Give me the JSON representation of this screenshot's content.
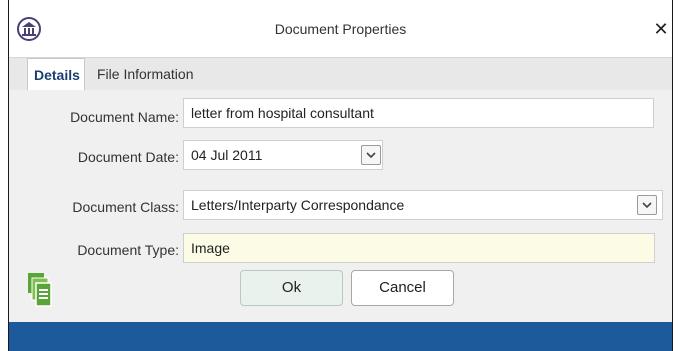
{
  "window": {
    "title": "Document Properties",
    "close_glyph": "✕"
  },
  "tabs": [
    {
      "label": "Details"
    },
    {
      "label": "File Information"
    }
  ],
  "form": {
    "name": {
      "label": "Document Name:",
      "value": "letter from hospital consultant"
    },
    "date": {
      "label": "Document Date:",
      "value": "04 Jul 2011"
    },
    "class": {
      "label": "Document Class:",
      "value": "Letters/Interparty Correspondance"
    },
    "type": {
      "label": "Document Type:",
      "value": "Image"
    }
  },
  "buttons": {
    "ok": "Ok",
    "cancel": "Cancel"
  },
  "icons": {
    "logo": "building-pillar-logo-icon",
    "copy": "copy-document-icon",
    "dropdown": "chevron-down-icon"
  },
  "colors": {
    "accent": "#1c5a9c",
    "readonly_bg": "#fcfce6",
    "ok_bg": "#e9f2ec",
    "copy_green": "#5aa53a"
  }
}
